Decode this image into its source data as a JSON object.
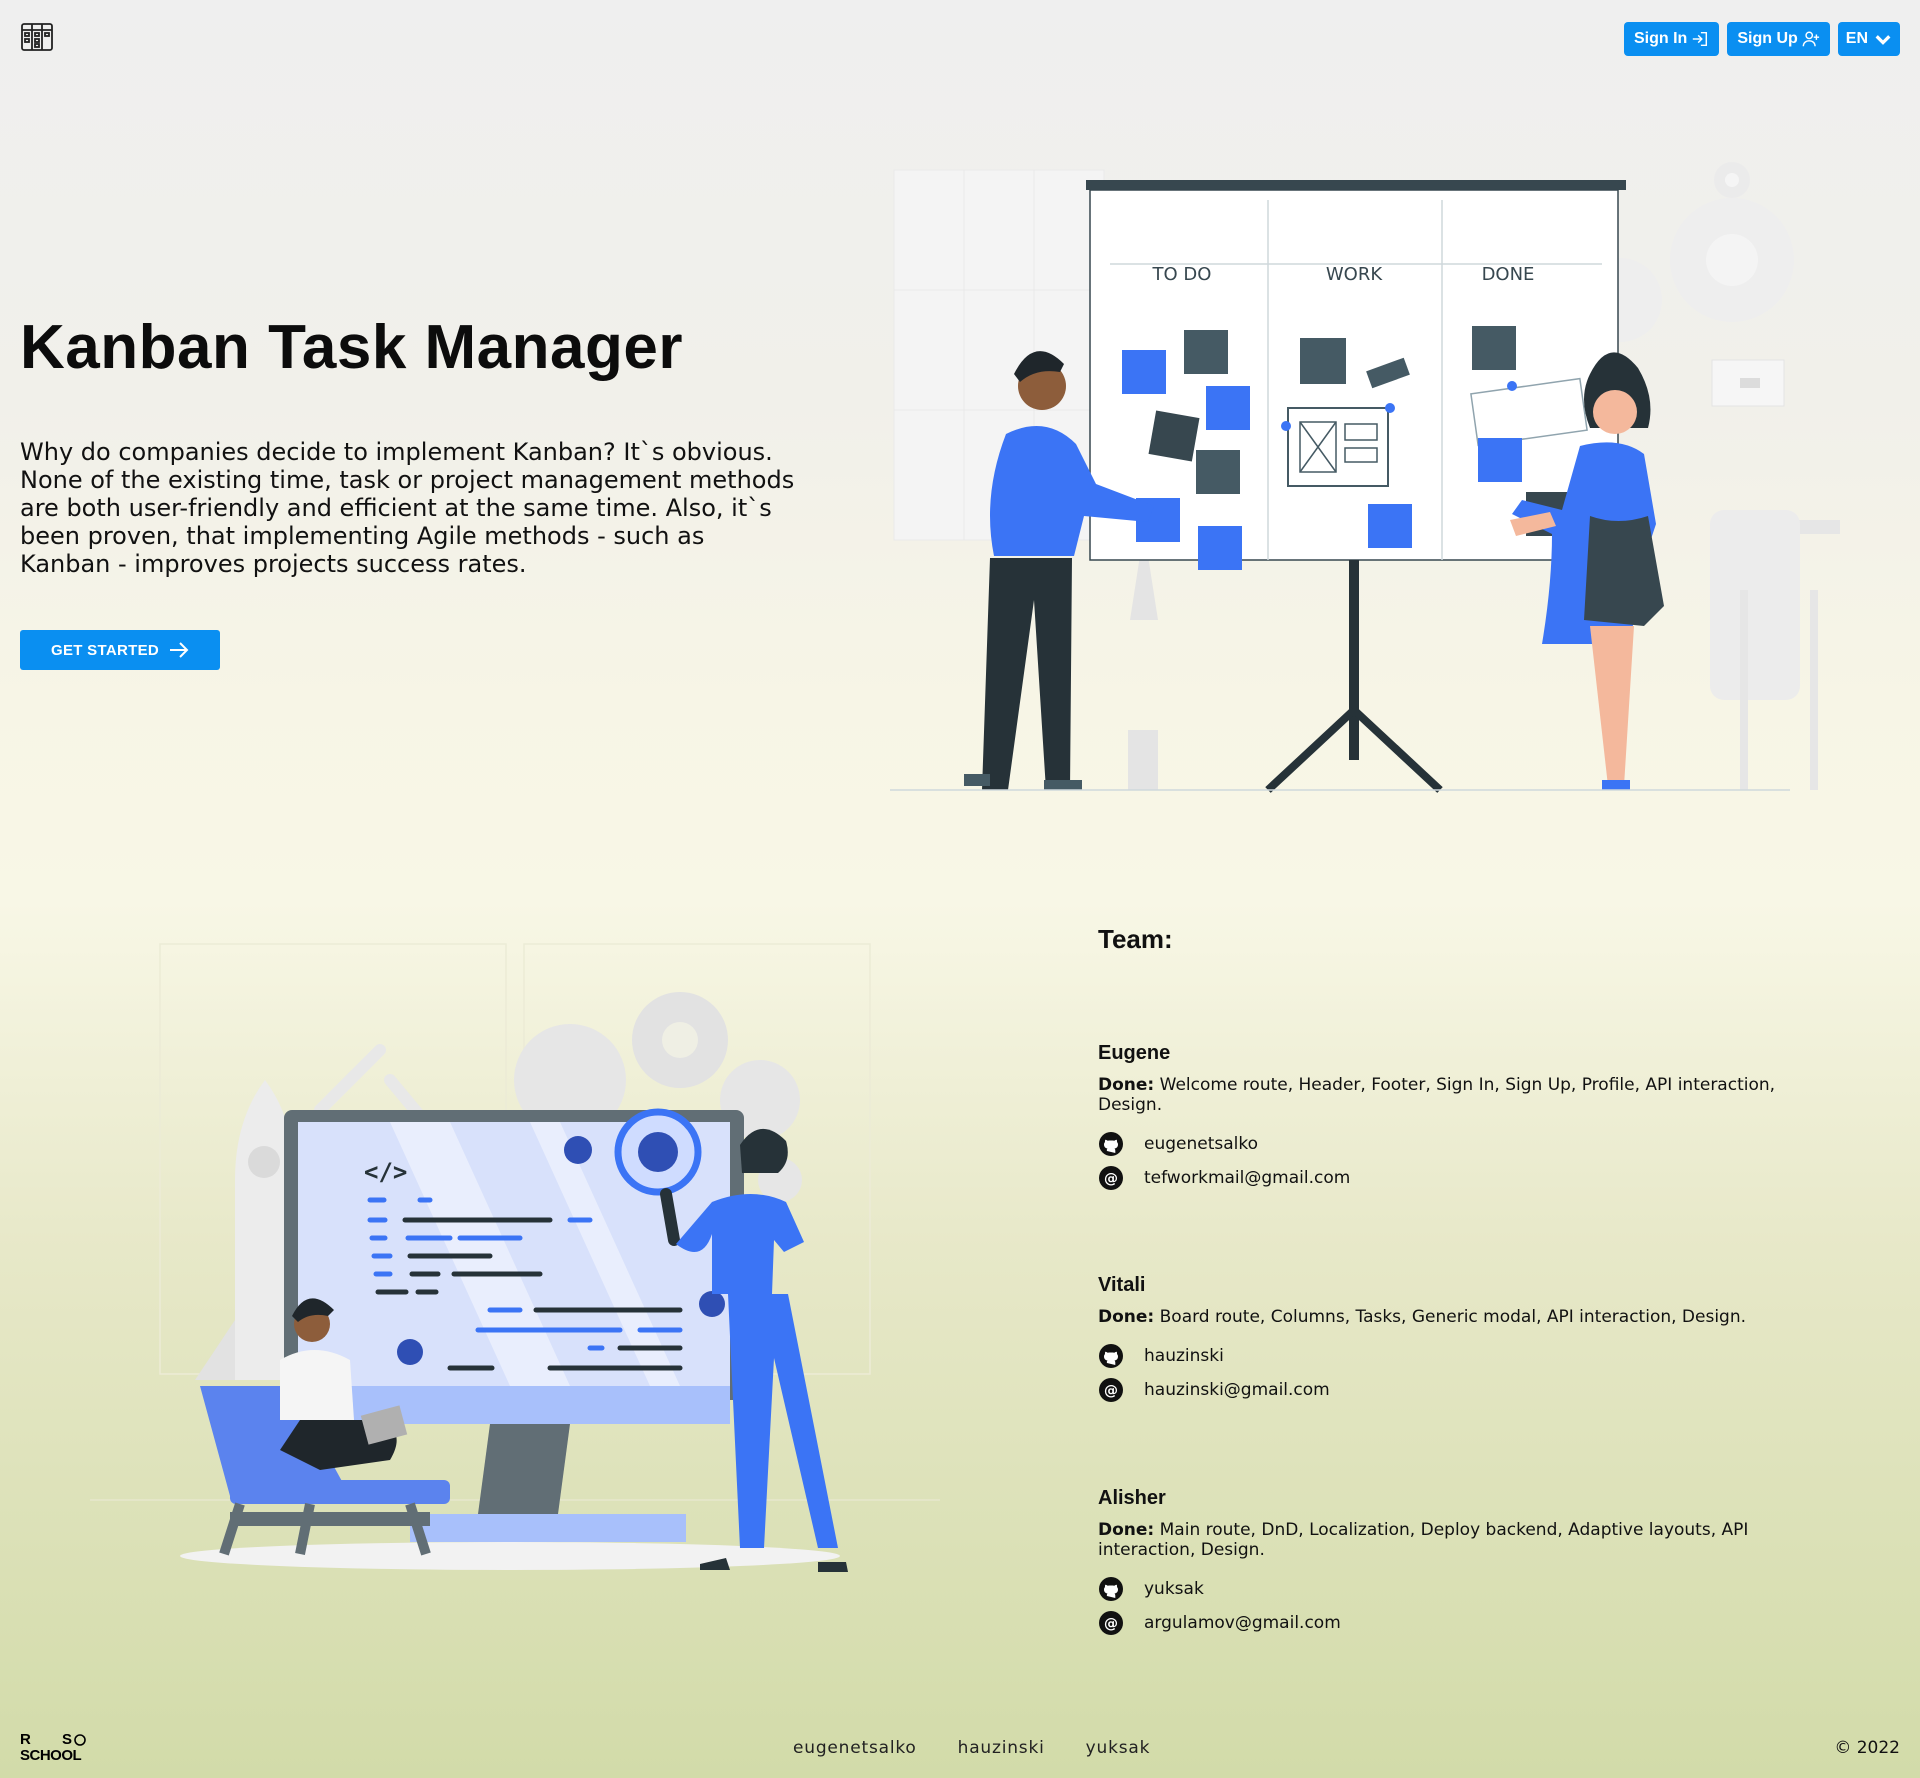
{
  "header": {
    "sign_in_label": "Sign In",
    "sign_up_label": "Sign Up",
    "language": "EN"
  },
  "hero": {
    "title": "Kanban Task Manager",
    "description": "Why do companies decide to implement Kanban? It`s obvious. None of the existing time, task or project management methods are both user-friendly and efficient at the same time. Also, it`s been proven, that implementing Agile methods - such as Kanban - improves projects success rates.",
    "cta_label": "GET STARTED",
    "board_columns": [
      "TO DO",
      "WORK",
      "DONE"
    ]
  },
  "team": {
    "heading": "Team:",
    "done_label": "Done:",
    "members": [
      {
        "name": "Eugene",
        "done": " Welcome route, Header, Footer, Sign In, Sign Up, Profile, API interaction, Design.",
        "github": "eugenetsalko",
        "email": "tefworkmail@gmail.com"
      },
      {
        "name": "Vitali",
        "done": " Board route, Columns, Tasks, Generic modal, API interaction, Design.",
        "github": "hauzinski",
        "email": "hauzinski@gmail.com"
      },
      {
        "name": "Alisher",
        "done": " Main route, DnD, Localization, Deploy backend, Adaptive layouts, API interaction, Design.",
        "github": "yuksak",
        "email": "argulamov@gmail.com"
      }
    ]
  },
  "footer": {
    "links": [
      "eugenetsalko",
      "hauzinski",
      "yuksak"
    ],
    "copyright": "2022",
    "logo_text": "RS SCHOOL"
  },
  "colors": {
    "accent": "#0a8ff1",
    "illustration_blue": "#3b74f5",
    "dark": "#263238"
  },
  "icons": {
    "logo": "kanban-board-icon",
    "sign_in": "login-icon",
    "sign_up": "add-user-icon",
    "language": "chevron-down-icon",
    "cta": "arrow-right-icon",
    "github": "github-icon",
    "email": "at-sign-icon",
    "copyright": "copyright-icon"
  }
}
